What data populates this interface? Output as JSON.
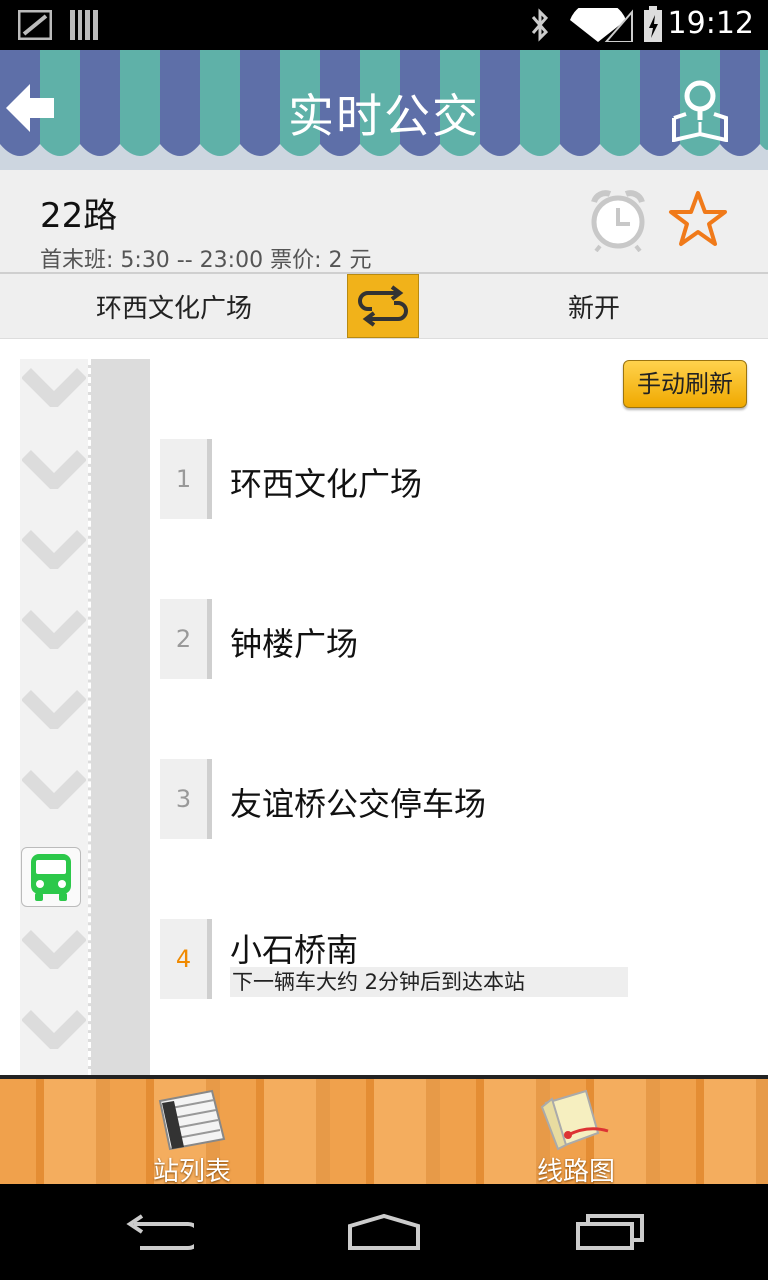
{
  "status_bar": {
    "time": "19:12"
  },
  "header": {
    "title": "实时公交"
  },
  "route": {
    "name": "22路",
    "meta": "首末班: 5:30 -- 23:00  票价: 2 元"
  },
  "direction": {
    "from": "环西文化广场",
    "to": "新开"
  },
  "refresh_label": "手动刷新",
  "stops": [
    {
      "num": "1",
      "name": "环西文化广场"
    },
    {
      "num": "2",
      "name": "钟楼广场"
    },
    {
      "num": "3",
      "name": "友谊桥公交停车场"
    },
    {
      "num": "4",
      "name": "小石桥南",
      "note": "下一辆车大约 2分钟后到达本站"
    }
  ],
  "tabs": [
    {
      "label": "站列表"
    },
    {
      "label": "线路图"
    }
  ],
  "colors": {
    "accent_orange": "#f08a00",
    "stripe_blue": "#5e6fa8",
    "stripe_teal": "#5fb1a8",
    "swap_yellow": "#f1b21a"
  }
}
